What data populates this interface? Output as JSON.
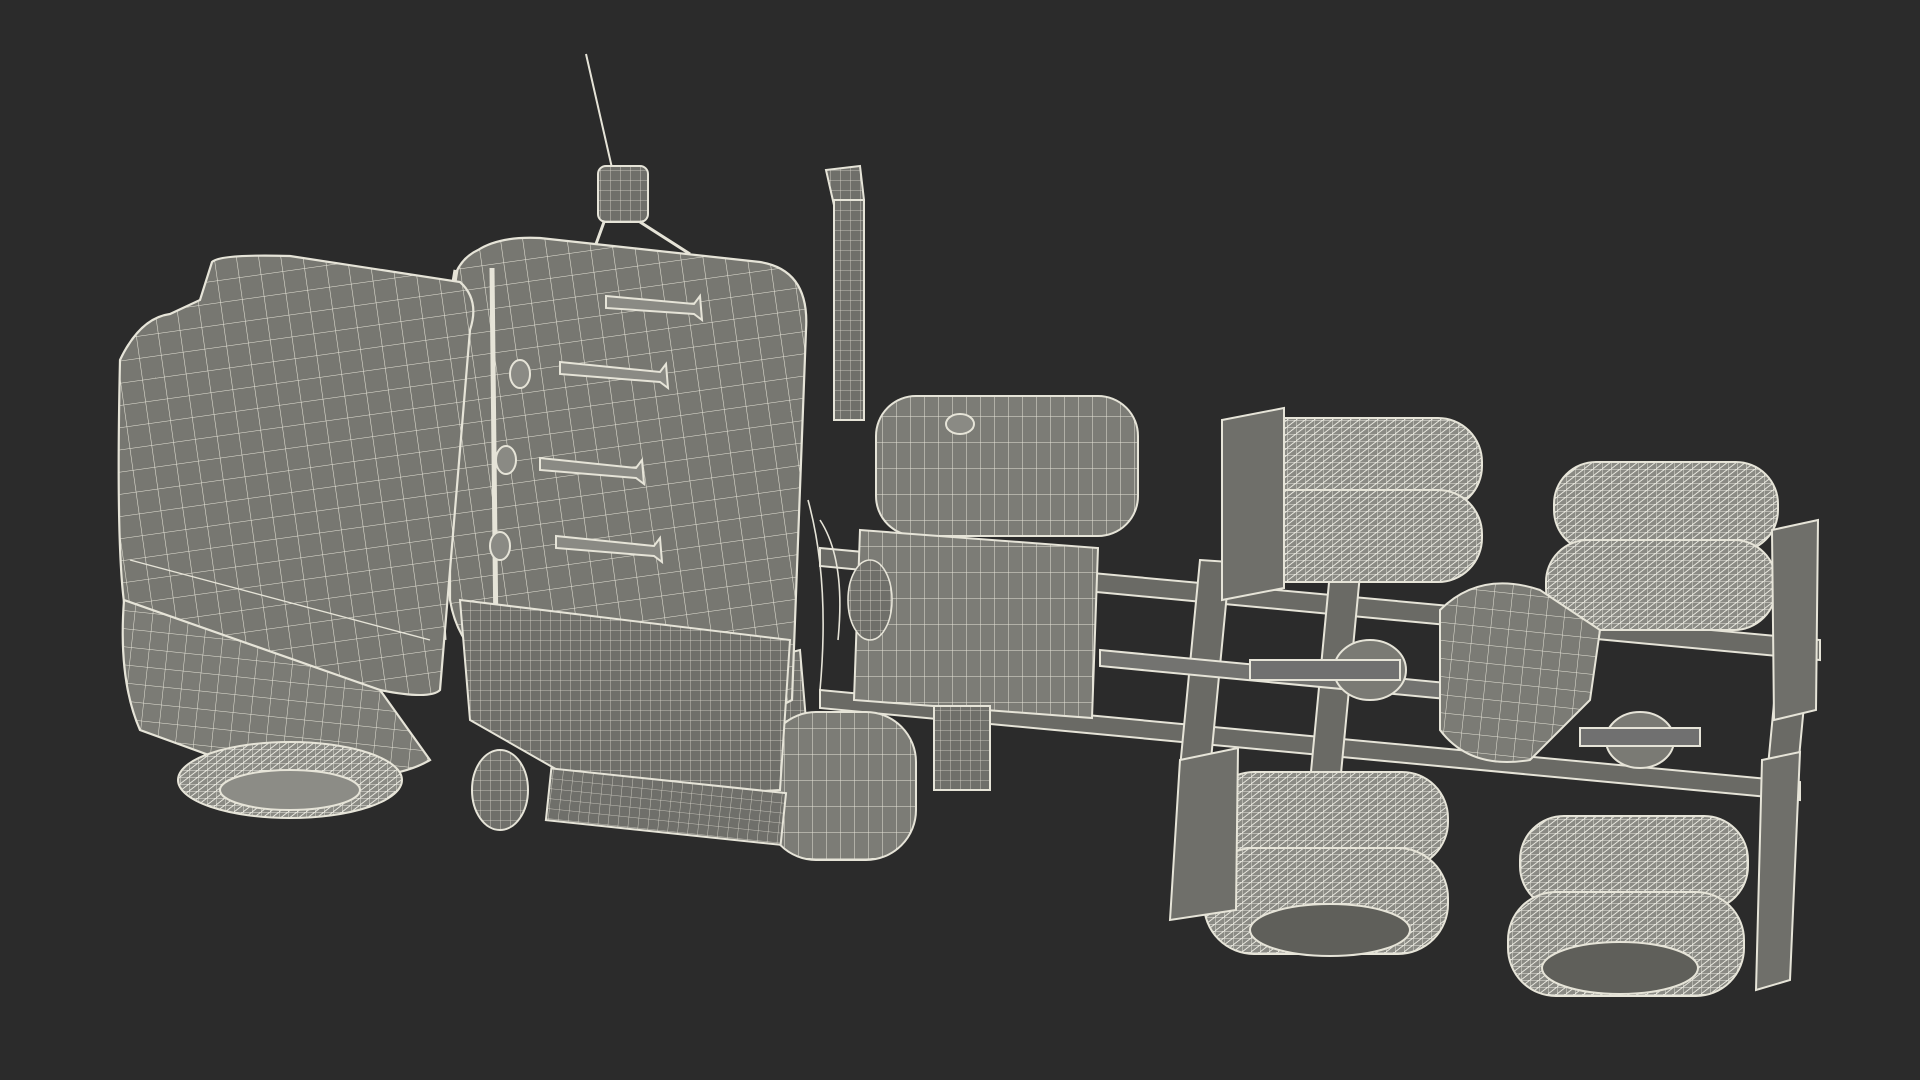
{
  "scene": {
    "background_color": "#2b2b2b",
    "body_fill": "#777771",
    "body_fill_light": "#85857f",
    "body_fill_dark": "#5f5f5a",
    "wire_color": "#e6e4d8",
    "wire_color_dim": "#bdbbb0",
    "subject": "semi-truck-wireframe-render"
  }
}
